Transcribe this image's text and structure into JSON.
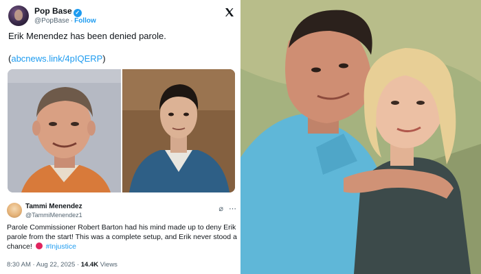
{
  "tweet": {
    "account_name": "Pop Base",
    "handle": "@PopBase",
    "follow_label": "Follow",
    "text": "Erik Menendez has been denied parole.",
    "link_open": "(",
    "link_text": "abcnews.link/4pIQERP",
    "link_close": ")"
  },
  "reply": {
    "name": "Tammi Menendez",
    "handle": "@TammiMenendez1",
    "text": "Parole Commissioner Robert Barton had his mind made up to deny Erik parole from the start! This was a complete setup, and Erik never stood a chance!",
    "hashtag": "#Injustice",
    "time": "8:30 AM",
    "date": "Aug 22, 2025",
    "views_count": "14.4K",
    "views_label": "Views"
  },
  "icons": {
    "verified": "verified-badge-icon",
    "x_logo": "x-logo-icon",
    "grok": "grok-icon",
    "more": "more-icon",
    "emoji": "sad-face-emoji"
  },
  "colors": {
    "link_blue": "#1d9bf0",
    "text_primary": "#0f1419",
    "text_secondary": "#536471"
  }
}
